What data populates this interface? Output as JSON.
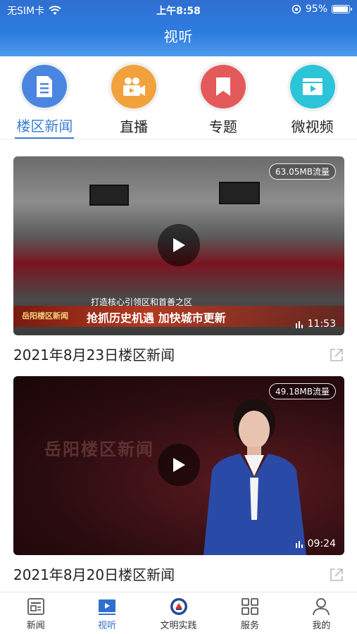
{
  "status_bar": {
    "carrier": "无SIM卡",
    "time": "上午8:58",
    "battery": "95%"
  },
  "page": {
    "title": "视听"
  },
  "categories": [
    {
      "label": "楼区新闻",
      "icon": "document-icon",
      "color": "#4a86e0",
      "active": true
    },
    {
      "label": "直播",
      "icon": "video-camera-icon",
      "color": "#f2a23c",
      "active": false
    },
    {
      "label": "专题",
      "icon": "bookmark-icon",
      "color": "#e45a5a",
      "active": false
    },
    {
      "label": "微视频",
      "icon": "film-play-icon",
      "color": "#2cc4d8",
      "active": false
    }
  ],
  "videos": [
    {
      "title": "2021年8月23日楼区新闻",
      "flow": "63.05MB流量",
      "duration": "11:53",
      "banner_sub": "打造核心引领区和首善之区",
      "banner_main": "抢抓历史机遇 加快城市更新",
      "banner_logo": "岳阳楼区新闻"
    },
    {
      "title": "2021年8月20日楼区新闻",
      "flow": "49.18MB流量",
      "duration": "09:24",
      "show_title": "岳阳楼区新闻"
    }
  ],
  "tabbar": [
    {
      "label": "新闻",
      "icon": "news-icon",
      "active": false
    },
    {
      "label": "视听",
      "icon": "media-icon",
      "active": true
    },
    {
      "label": "文明实践",
      "icon": "civilization-badge-icon",
      "active": false
    },
    {
      "label": "服务",
      "icon": "grid-icon",
      "active": false
    },
    {
      "label": "我的",
      "icon": "user-icon",
      "active": false
    }
  ],
  "colors": {
    "header": "#2f6fd0",
    "accent": "#3a7fd0"
  }
}
